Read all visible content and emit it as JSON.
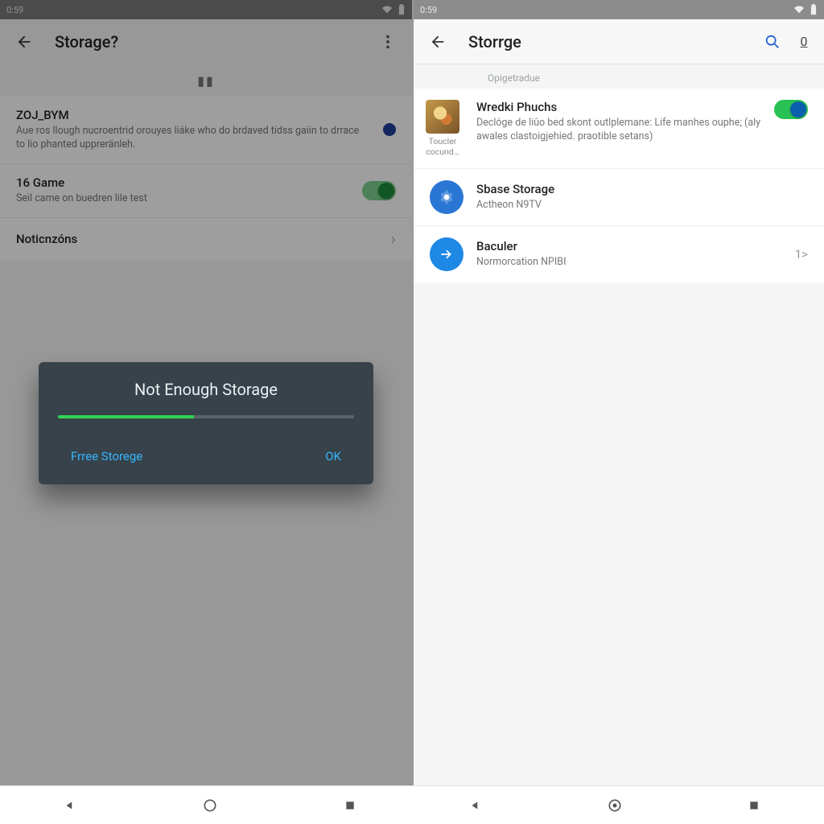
{
  "left": {
    "status_time": "0:59",
    "appbar_title": "Storage?",
    "items": {
      "zoj": {
        "title": "ZOJ_BYM",
        "desc": "Aue ros llough nucroentrid orouyes liáke who do brdaved tidss gaiin to drrace to lio phanted uppreränleh."
      },
      "game": {
        "title": "16 Game",
        "desc": "Seil came on buedren lile test"
      },
      "notif": {
        "title": "Noticnzóns"
      }
    },
    "dialog": {
      "title": "Not Enough Storage",
      "free_btn": "Frree Storege",
      "ok_btn": "OK",
      "progress_pct": 46
    }
  },
  "right": {
    "status_time": "0:59",
    "appbar_title": "Storrge",
    "appbar_badge": "0",
    "subheader": "Opigetradue",
    "items": {
      "wredki": {
        "title": "Wredki Phuchs",
        "left_caption": "Toucler cocund…",
        "desc": "Declóge de liûo bed skont outlplemane: Life manhes ouphe; (aly awales clastoigjehied. praotible setans)"
      },
      "spase": {
        "title": "Sbase Storage",
        "desc": "Actheon N9TV"
      },
      "baculer": {
        "title": "Baculer",
        "desc": "Normorcation NPIBI",
        "trailing": "1>"
      }
    }
  }
}
